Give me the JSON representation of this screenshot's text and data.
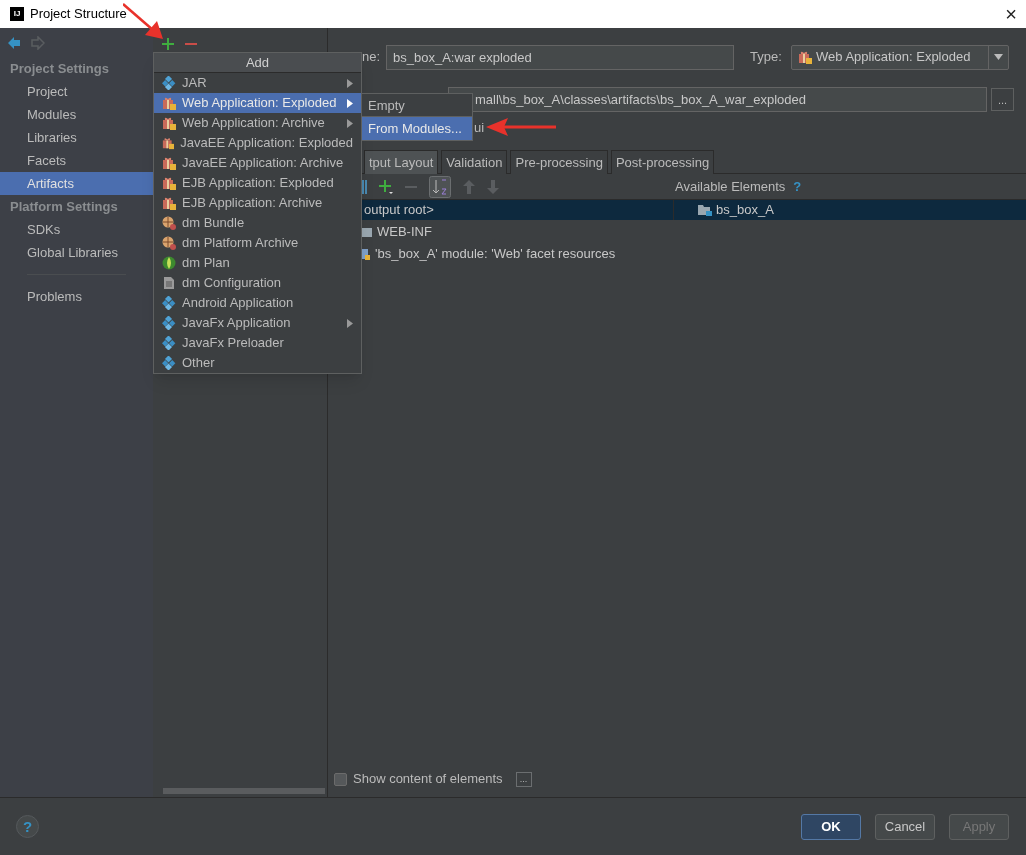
{
  "window": {
    "logo": "IJ",
    "title": "Project Structure",
    "close": "×"
  },
  "sidebar": {
    "groups": [
      {
        "title": "Project Settings",
        "items": [
          {
            "label": "Project",
            "selected": false
          },
          {
            "label": "Modules",
            "selected": false
          },
          {
            "label": "Libraries",
            "selected": false
          },
          {
            "label": "Facets",
            "selected": false
          },
          {
            "label": "Artifacts",
            "selected": true
          }
        ]
      },
      {
        "title": "Platform Settings",
        "items": [
          {
            "label": "SDKs",
            "selected": false
          },
          {
            "label": "Global Libraries",
            "selected": false
          }
        ]
      }
    ],
    "problems": "Problems"
  },
  "add_menu": {
    "title": "Add",
    "items": [
      {
        "label": "JAR",
        "kind": "diamond",
        "submenu": true,
        "selected": false
      },
      {
        "label": "Web Application: Exploded",
        "kind": "gift",
        "submenu": true,
        "selected": true
      },
      {
        "label": "Web Application: Archive",
        "kind": "gift",
        "submenu": true,
        "selected": false
      },
      {
        "label": "JavaEE Application: Exploded",
        "kind": "gift",
        "submenu": false,
        "selected": false
      },
      {
        "label": "JavaEE Application: Archive",
        "kind": "gift",
        "submenu": false,
        "selected": false
      },
      {
        "label": "EJB Application: Exploded",
        "kind": "gift",
        "submenu": false,
        "selected": false
      },
      {
        "label": "EJB Application: Archive",
        "kind": "gift",
        "submenu": false,
        "selected": false
      },
      {
        "label": "dm Bundle",
        "kind": "bundle",
        "submenu": false,
        "selected": false
      },
      {
        "label": "dm Platform Archive",
        "kind": "bundle",
        "submenu": false,
        "selected": false
      },
      {
        "label": "dm Plan",
        "kind": "globe",
        "submenu": false,
        "selected": false
      },
      {
        "label": "dm Configuration",
        "kind": "document",
        "submenu": false,
        "selected": false
      },
      {
        "label": "Android Application",
        "kind": "diamond",
        "submenu": false,
        "selected": false
      },
      {
        "label": "JavaFx Application",
        "kind": "diamond",
        "submenu": true,
        "selected": false
      },
      {
        "label": "JavaFx Preloader",
        "kind": "diamond",
        "submenu": false,
        "selected": false
      },
      {
        "label": "Other",
        "kind": "diamond",
        "submenu": false,
        "selected": false
      }
    ]
  },
  "submenu": {
    "items": [
      {
        "label": "Empty",
        "selected": false
      },
      {
        "label": "From Modules...",
        "selected": true
      }
    ]
  },
  "artifact": {
    "name_label": "ne:",
    "name": "bs_box_A:war exploded",
    "type_label": "Type:",
    "type": "Web Application: Exploded",
    "output_path": "mall\\bs_box_A\\classes\\artifacts\\bs_box_A_war_exploded",
    "browse": "...",
    "build_fragment": "ui"
  },
  "tabs": [
    {
      "label": "tput Layout",
      "selected": true
    },
    {
      "label": "Validation",
      "selected": false
    },
    {
      "label": "Pre-processing",
      "selected": false
    },
    {
      "label": "Post-processing",
      "selected": false
    }
  ],
  "layout": {
    "available_label": "Available Elements",
    "help": "?",
    "tree": [
      {
        "label": "output root>",
        "selected": true,
        "children": [
          {
            "label": "WEB-INF",
            "kind": "folder"
          },
          {
            "label": "'bs_box_A' module: 'Web' facet resources",
            "kind": "module"
          }
        ]
      }
    ],
    "available": [
      {
        "label": "bs_box_A",
        "selected": true
      }
    ]
  },
  "show_content": {
    "label": "Show content of elements",
    "checked": false,
    "button": "..."
  },
  "footer": {
    "help": "?",
    "buttons": [
      {
        "label": "OK",
        "kind": "primary",
        "disabled": false
      },
      {
        "label": "Cancel",
        "kind": "normal",
        "disabled": false
      },
      {
        "label": "Apply",
        "kind": "normal",
        "disabled": true
      }
    ]
  }
}
